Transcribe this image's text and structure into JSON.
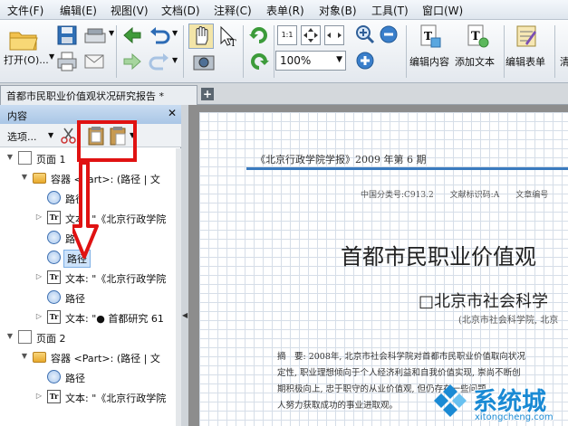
{
  "menubar": {
    "items": [
      "文件(F)",
      "编辑(E)",
      "视图(V)",
      "文档(D)",
      "注释(C)",
      "表单(R)",
      "对象(B)",
      "工具(T)",
      "窗口(W)"
    ]
  },
  "toolbar": {
    "open_label": "打开(O)...",
    "zoom_value": "100%",
    "edit_content_label": "编辑内容",
    "add_text_label": "添加文本",
    "edit_form_label": "编辑表单",
    "cut_off_label": "清"
  },
  "tabs": {
    "document_tab": "首都市民职业价值观状况研究报告 *",
    "new_tab_icon": "plus-icon"
  },
  "panel": {
    "title": "内容",
    "options_label": "选项...",
    "tree": [
      {
        "indent": 0,
        "toggle": "▼",
        "icon": "page-icon",
        "label": "页面 1"
      },
      {
        "indent": 1,
        "toggle": "▼",
        "icon": "folder-icon",
        "label": "容器 <Part>: (路径 | 文"
      },
      {
        "indent": 2,
        "toggle": "",
        "icon": "path-icon",
        "label": "路径"
      },
      {
        "indent": 2,
        "toggle": "▷",
        "icon": "text-icon",
        "label": "文本: \"《北京行政学院"
      },
      {
        "indent": 2,
        "toggle": "",
        "icon": "path-icon",
        "label": "路径"
      },
      {
        "indent": 2,
        "toggle": "",
        "icon": "path-icon",
        "label": "路径",
        "selected": true
      },
      {
        "indent": 2,
        "toggle": "▷",
        "icon": "text-icon",
        "label": "文本: \"《北京行政学院"
      },
      {
        "indent": 2,
        "toggle": "",
        "icon": "path-icon",
        "label": "路径"
      },
      {
        "indent": 2,
        "toggle": "▷",
        "icon": "text-icon",
        "label": "文本: \"● 首都研究 61"
      },
      {
        "indent": 0,
        "toggle": "▼",
        "icon": "page-icon",
        "label": "页面 2"
      },
      {
        "indent": 1,
        "toggle": "▼",
        "icon": "folder-icon",
        "label": "容器 <Part>: (路径 | 文"
      },
      {
        "indent": 2,
        "toggle": "",
        "icon": "path-icon",
        "label": "路径"
      },
      {
        "indent": 2,
        "toggle": "▷",
        "icon": "text-icon",
        "label": "文本: \"《北京行政学院"
      }
    ]
  },
  "document": {
    "journal_header": "《北京行政学院学报》2009 年第 6 期",
    "classification": "中国分类号:C913.2　　文献标识码:A　　文章编号",
    "title": "首都市民职业价值观",
    "author": "□北京市社会科学",
    "affiliation": "(北京市社会科学院, 北京",
    "abstract_lines": [
      "摘　要: 2008年, 北京市社会科学院对首都市民职业价值取向状况",
      "定性, 职业理想倾向于个人经济利益和自我价值实现, 崇尚不断创",
      "期积极向上, 忠于职守的从业价值观, 但仍存在一些问题",
      "人努力获取成功的事业进取观。"
    ]
  },
  "watermark": {
    "name": "系统城",
    "url": "xitongcheng.com"
  },
  "colors": {
    "annotation_red": "#e01212",
    "rule_blue": "#3b7bbf",
    "watermark_blue": "#1a8ad4"
  }
}
